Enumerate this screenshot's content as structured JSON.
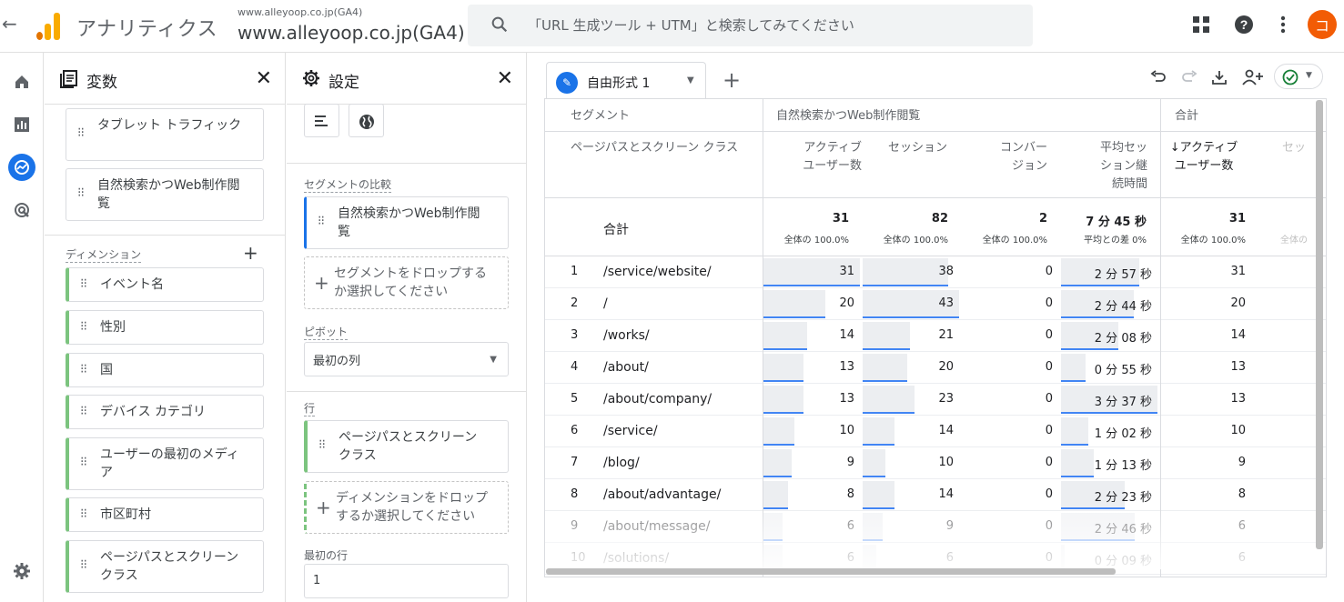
{
  "topbar": {
    "app_title": "アナリティクス",
    "property_small": "www.alleyoop.co.jp(GA4)",
    "property_main": "www.alleyoop.co.jp(GA4)",
    "search_placeholder": "「URL 生成ツール + UTM」と検索してみてください",
    "avatar_letter": "コ"
  },
  "variables_panel": {
    "title": "変数",
    "segments": [
      "タブレット トラフィック",
      "自然検索かつWeb制作閲覧"
    ],
    "dimensions_label": "ディメンション",
    "dimensions": [
      "イベント名",
      "性別",
      "国",
      "デバイス カテゴリ",
      "ユーザーの最初のメディア",
      "市区町村",
      "ページパスとスクリーン クラス"
    ]
  },
  "settings_panel": {
    "title": "設定",
    "segment_compare_label": "セグメントの比較",
    "segment_chip": "自然検索かつWeb制作閲覧",
    "segment_drop": "セグメントをドロップするか選択してください",
    "pivot_label": "ピボット",
    "pivot_value": "最初の列",
    "rows_label": "行",
    "row_chip": "ページパスとスクリーン クラス",
    "row_drop": "ディメンションをドロップするか選択してください",
    "first_row_label": "最初の行",
    "first_row_value": "1"
  },
  "tabs": {
    "active": "自由形式 1"
  },
  "table": {
    "segment_header": "セグメント",
    "dimension_header": "ページパスとスクリーン クラス",
    "segment_name": "自然検索かつWeb制作閲覧",
    "total_group": "合計",
    "columns": [
      "アクティブユーザー数",
      "セッション",
      "コンバージョン",
      "平均セッション継続時間"
    ],
    "columns_display": [
      "アクティブ\nユーザー数",
      "セッション",
      "コンバー\nジョン",
      "平均セッ\nション継\n続時間"
    ],
    "total_col_header": "↓アクティブ\nユーザー数",
    "total_col_cut": "セッ",
    "total_label": "合計",
    "totals": [
      "31",
      "82",
      "2",
      "7 分 45 秒"
    ],
    "totals_sub": [
      "全体の 100.0%",
      "全体の 100.0%",
      "全体の 100.0%",
      "平均との差 0%"
    ],
    "total_right": "31",
    "total_right_sub": "全体の 100.0%",
    "total_cut_sub": "全体の",
    "rows": [
      {
        "i": "1",
        "path": "/service/website/",
        "users": "31",
        "sessions": "38",
        "conv": "0",
        "dur": "2 分 57 秒",
        "total": "31"
      },
      {
        "i": "2",
        "path": "/",
        "users": "20",
        "sessions": "43",
        "conv": "0",
        "dur": "2 分 44 秒",
        "total": "20"
      },
      {
        "i": "3",
        "path": "/works/",
        "users": "14",
        "sessions": "21",
        "conv": "0",
        "dur": "2 分 08 秒",
        "total": "14"
      },
      {
        "i": "4",
        "path": "/about/",
        "users": "13",
        "sessions": "20",
        "conv": "0",
        "dur": "0 分 55 秒",
        "total": "13"
      },
      {
        "i": "5",
        "path": "/about/company/",
        "users": "13",
        "sessions": "23",
        "conv": "0",
        "dur": "3 分 37 秒",
        "total": "13"
      },
      {
        "i": "6",
        "path": "/service/",
        "users": "10",
        "sessions": "14",
        "conv": "0",
        "dur": "1 分 02 秒",
        "total": "10"
      },
      {
        "i": "7",
        "path": "/blog/",
        "users": "9",
        "sessions": "10",
        "conv": "0",
        "dur": "1 分 13 秒",
        "total": "9"
      },
      {
        "i": "8",
        "path": "/about/advantage/",
        "users": "8",
        "sessions": "14",
        "conv": "0",
        "dur": "2 分 23 秒",
        "total": "8"
      },
      {
        "i": "9",
        "path": "/about/message/",
        "users": "6",
        "sessions": "9",
        "conv": "0",
        "dur": "2 分 46 秒",
        "total": "6"
      },
      {
        "i": "10",
        "path": "/solutions/",
        "users": "6",
        "sessions": "6",
        "conv": "0",
        "dur": "0 分 09 秒",
        "total": "6"
      }
    ]
  },
  "chart_data": {
    "type": "table",
    "bar_fraction": {
      "users": [
        1.0,
        0.645,
        0.452,
        0.419,
        0.419,
        0.323,
        0.29,
        0.258,
        0.194,
        0.194
      ],
      "sessions": [
        0.884,
        1.0,
        0.488,
        0.465,
        0.535,
        0.326,
        0.233,
        0.326,
        0.209,
        0.14
      ],
      "duration": [
        0.816,
        0.756,
        0.59,
        0.253,
        1.0,
        0.286,
        0.336,
        0.659,
        0.765,
        0.041
      ]
    }
  },
  "colors": {
    "accent": "#1a73e8",
    "brand_orange": "#f9ab00",
    "chip_green": "#7cc47f"
  }
}
